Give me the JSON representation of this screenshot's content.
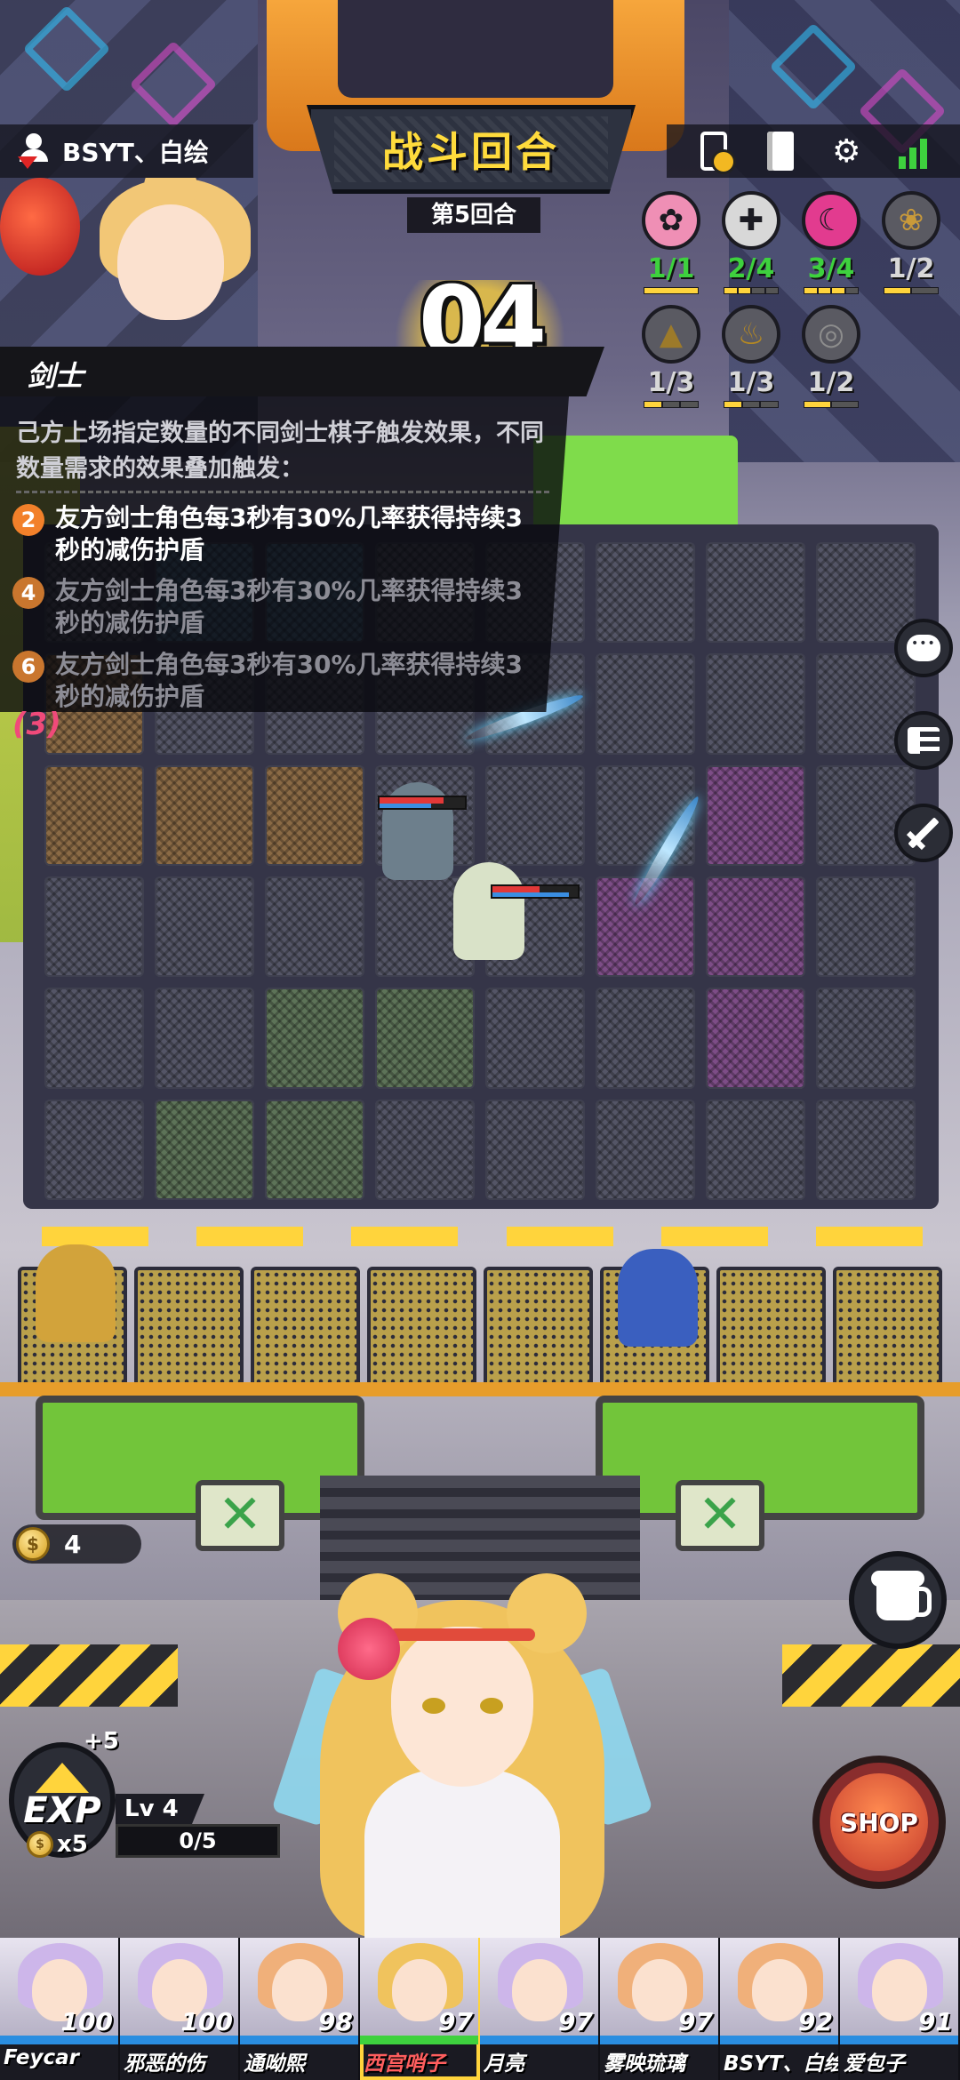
{
  "header": {
    "player_label": "BSYT、白绘",
    "round_title": "战斗回合",
    "round_number_label": "第5回合",
    "countdown": "04"
  },
  "top_icons": [
    "phone-sync-icon",
    "codex-book-icon",
    "settings-gear-icon",
    "signal-strength-icon"
  ],
  "synergies": [
    {
      "icon": "sakura-icon",
      "count": "1/1",
      "active": true,
      "color": "#ef8fb5",
      "count_color": "#3ed13e",
      "level": 1,
      "max": 1
    },
    {
      "icon": "cross-shield-icon",
      "count": "2/4",
      "active": true,
      "color": "#d8d8d8",
      "count_color": "#3ed13e",
      "level": 2,
      "max": 4
    },
    {
      "icon": "blade-swirl-icon",
      "count": "3/4",
      "active": true,
      "color": "#e23b8f",
      "count_color": "#3ed13e",
      "level": 3,
      "max": 4
    },
    {
      "icon": "lotus-icon",
      "count": "1/2",
      "active": false,
      "color": "#c99a3a",
      "count_color": "#d8d8d8",
      "level": 1,
      "max": 2
    },
    {
      "icon": "hood-icon",
      "count": "1/3",
      "active": false,
      "color": "#9c7a2a",
      "count_color": "#d8d8d8",
      "level": 1,
      "max": 3
    },
    {
      "icon": "flame-icon",
      "count": "1/3",
      "active": false,
      "color": "#b88a20",
      "count_color": "#d8d8d8",
      "level": 1,
      "max": 3
    },
    {
      "icon": "ring-icon",
      "count": "1/2",
      "active": false,
      "color": "#8d8d8d",
      "count_color": "#d8d8d8",
      "level": 1,
      "max": 2
    }
  ],
  "synergy_panel": {
    "title": "剑士",
    "description": "己方上场指定数量的不同剑士棋子触发效果，不同数量需求的效果叠加触发：",
    "effects": [
      {
        "required": "2",
        "text": "友方剑士角色每3秒有30%几率获得持续3秒的减伤护盾",
        "active": true
      },
      {
        "required": "4",
        "text": "友方剑士角色每3秒有30%几率获得持续3秒的减伤护盾",
        "active": false
      },
      {
        "required": "6",
        "text": "友方剑士角色每3秒有30%几率获得持续3秒的减伤护盾",
        "active": false
      }
    ],
    "current_count": "(3)"
  },
  "side_buttons": [
    "chat-icon",
    "player-list-icon",
    "equipment-sword-icon"
  ],
  "economy": {
    "gold": "4",
    "exp_label": "EXP",
    "exp_gain": "+5",
    "exp_cost": "x5",
    "level": "Lv 4",
    "xp_progress": "0/5",
    "xp_fraction": 0.0,
    "shop_label": "SHOP"
  },
  "roster": [
    {
      "name": "Feycar",
      "score": "100",
      "hair": "#cdb6ea",
      "self": false,
      "selected": false
    },
    {
      "name": "邪恶的伤",
      "score": "100",
      "hair": "#cdb6ea",
      "self": false,
      "selected": false
    },
    {
      "name": "通呦熙",
      "score": "98",
      "hair": "#f0b07a",
      "self": false,
      "selected": false
    },
    {
      "name": "西宫哨子",
      "score": "97",
      "hair": "#f0c35d",
      "self": false,
      "selected": true
    },
    {
      "name": "月亮",
      "score": "97",
      "hair": "#cdb6ea",
      "self": false,
      "selected": false
    },
    {
      "name": "雾映琉璃",
      "score": "97",
      "hair": "#f0b07a",
      "self": false,
      "selected": false
    },
    {
      "name": "BSYT、白绘",
      "score": "92",
      "hair": "#f0b07a",
      "self": true,
      "selected": false
    },
    {
      "name": "爱包子",
      "score": "91",
      "hair": "#cdb6ea",
      "self": false,
      "selected": false
    }
  ]
}
